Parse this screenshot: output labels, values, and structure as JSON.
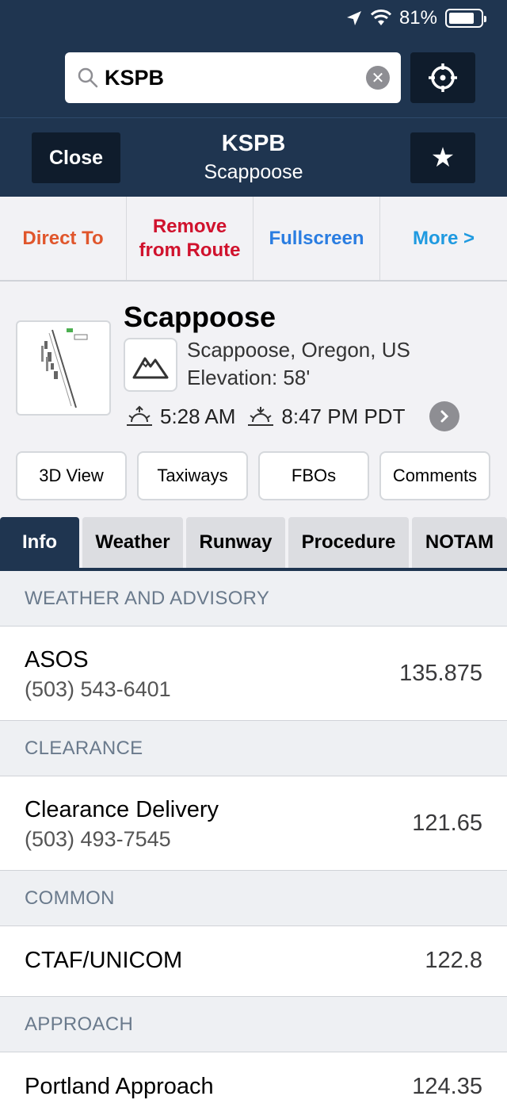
{
  "status": {
    "battery": "81%"
  },
  "search": {
    "value": "KSPB"
  },
  "nav": {
    "close_label": "Close",
    "title": "KSPB",
    "subtitle": "Scappoose",
    "favorite_icon": "star-icon"
  },
  "actions": [
    {
      "label": "Direct To",
      "color": "#e0562c"
    },
    {
      "label": "Remove from Route",
      "color": "#d0122d"
    },
    {
      "label": "Fullscreen",
      "color": "#2a7de1"
    },
    {
      "label": "More >",
      "color": "#1f9ae0"
    }
  ],
  "airport": {
    "name": "Scappoose",
    "location": "Scappoose, Oregon, US",
    "elevation": "Elevation: 58'",
    "sunrise": "5:28 AM",
    "sunset": "8:47 PM PDT"
  },
  "buttons": [
    "3D View",
    "Taxiways",
    "FBOs",
    "Comments"
  ],
  "tabs": [
    {
      "label": "Info",
      "active": true
    },
    {
      "label": "Weather",
      "active": false
    },
    {
      "label": "Runway",
      "active": false
    },
    {
      "label": "Procedure",
      "active": false
    },
    {
      "label": "NOTAM",
      "active": false
    }
  ],
  "sections": [
    {
      "header": "WEATHER AND ADVISORY",
      "rows": [
        {
          "name": "ASOS",
          "phone": "(503) 543-6401",
          "freq": "135.875"
        }
      ]
    },
    {
      "header": "CLEARANCE",
      "rows": [
        {
          "name": "Clearance Delivery",
          "phone": "(503) 493-7545",
          "freq": "121.65"
        }
      ]
    },
    {
      "header": "COMMON",
      "rows": [
        {
          "name": "CTAF/UNICOM",
          "phone": "",
          "freq": "122.8"
        }
      ]
    },
    {
      "header": "APPROACH",
      "rows": [
        {
          "name": "Portland Approach",
          "phone": "",
          "freq": "124.35"
        }
      ]
    }
  ]
}
